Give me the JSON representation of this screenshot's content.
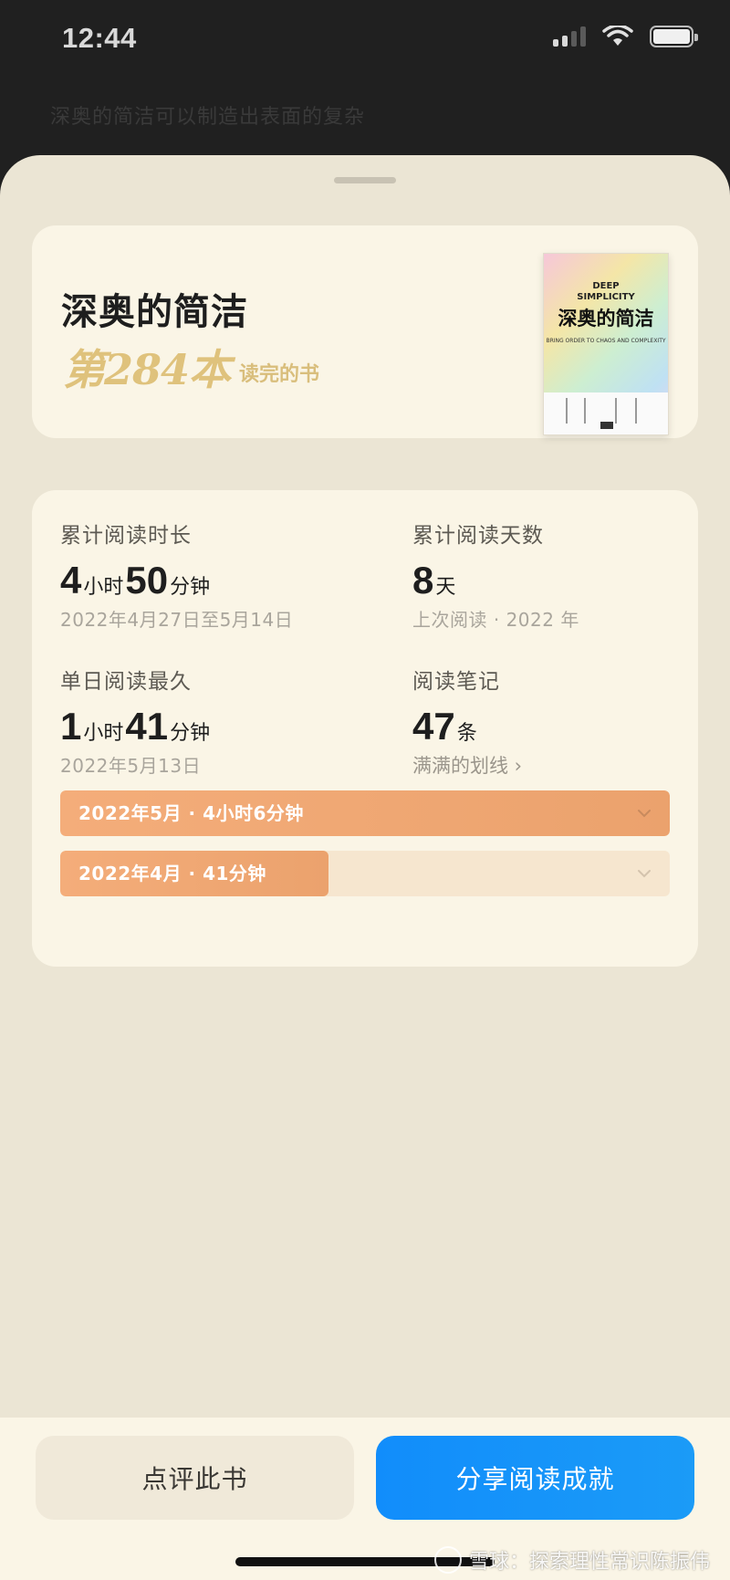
{
  "status_bar": {
    "time": "12:44"
  },
  "background_page": {
    "quote": "深奥的简洁可以制造出表面的复杂"
  },
  "book": {
    "title": "深奥的简洁",
    "rank_number": "第284本",
    "rank_suffix": "读完的书",
    "cover": {
      "title_en_line1": "DEEP",
      "title_en_line2": "SIMPLICITY",
      "title_cn": "深奥的简洁",
      "subtitle": "BRING ORDER TO CHAOS AND COMPLEXITY"
    }
  },
  "stats": {
    "total_time": {
      "label": "累计阅读时长",
      "hours": "4",
      "hours_unit": "小时",
      "minutes": "50",
      "minutes_unit": "分钟",
      "sub": "2022年4月27日至5月14日"
    },
    "total_days": {
      "label": "累计阅读天数",
      "value": "8",
      "unit": "天",
      "sub": "上次阅读 · 2022 年"
    },
    "longest_day": {
      "label": "单日阅读最久",
      "hours": "1",
      "hours_unit": "小时",
      "minutes": "41",
      "minutes_unit": "分钟",
      "sub": "2022年5月13日"
    },
    "notes": {
      "label": "阅读笔记",
      "value": "47",
      "unit": "条",
      "link": "满满的划线 ›"
    }
  },
  "monthly": [
    {
      "label": "2022年5月 · 4小时6分钟",
      "fraction": 1.0
    },
    {
      "label": "2022年4月 · 41分钟",
      "fraction": 0.44
    }
  ],
  "actions": {
    "review_label": "点评此书",
    "share_label": "分享阅读成就"
  },
  "watermark": "雪球：探索理性常识陈振伟",
  "colors": {
    "accent_blue": "#118dfb",
    "bar_orange": "#f4ad7a",
    "rank_gold": "#dfc27c",
    "card_bg": "#faf5e6"
  }
}
